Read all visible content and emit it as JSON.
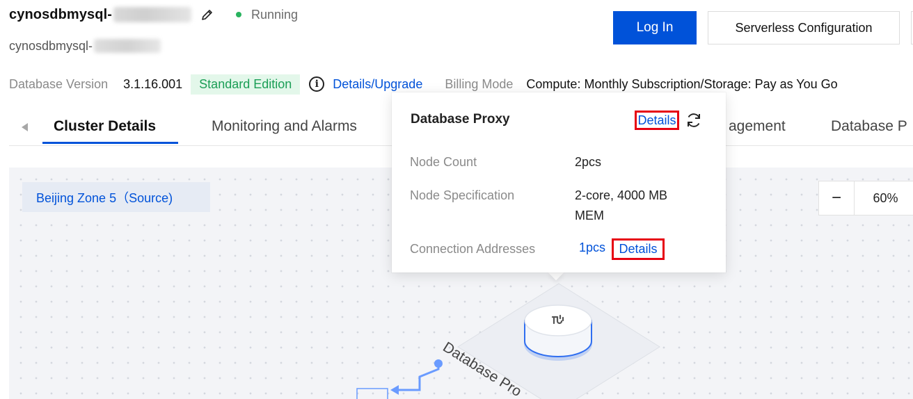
{
  "header": {
    "instance_name": "cynosdbmysql-",
    "status": "Running",
    "instance_id": "cynosdbmysql-",
    "login_label": "Log In",
    "serverless_label": "Serverless Configuration"
  },
  "info": {
    "version_label": "Database Version",
    "version_value": "3.1.16.001",
    "edition_tag": "Standard Edition",
    "upgrade_link": "Details/Upgrade",
    "billing_label": "Billing Mode",
    "billing_value": "Compute: Monthly Subscription/Storage: Pay as You Go"
  },
  "tabs": [
    {
      "label": "Cluster Details",
      "active": true
    },
    {
      "label": "Monitoring and Alarms",
      "active": false
    },
    {
      "label": "agement",
      "active": false
    },
    {
      "label": "Database P",
      "active": false
    }
  ],
  "canvas": {
    "zone_label": "Beijing Zone 5（Source)",
    "zoom_minus": "−",
    "zoom_value": "60%",
    "node_label": "Database Pro"
  },
  "popover": {
    "title": "Database Proxy",
    "details_label": "Details",
    "rows": [
      {
        "label": "Node Count",
        "value": "2pcs"
      },
      {
        "label": "Node Specification",
        "value": "2-core, 4000 MB MEM"
      },
      {
        "label": "Connection Addresses",
        "count": "1pcs",
        "link": "Details"
      }
    ]
  },
  "colors": {
    "primary": "#0052d9",
    "running": "#29b35f",
    "highlight": "#e60012"
  },
  "icons": [
    "edit-icon",
    "info-icon",
    "refresh-icon",
    "proxy-icon",
    "chevron-left-icon"
  ]
}
